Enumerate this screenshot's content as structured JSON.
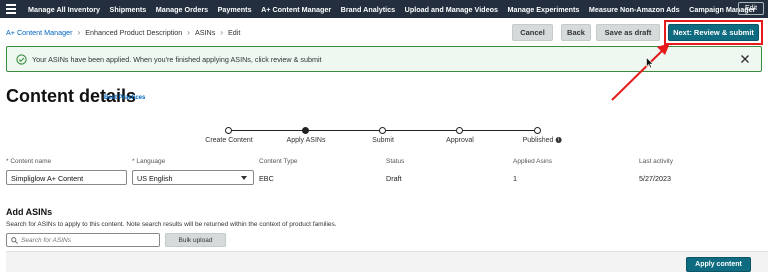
{
  "topnav": {
    "items": [
      "Manage All Inventory",
      "Shipments",
      "Manage Orders",
      "Payments",
      "A+ Content Manager",
      "Brand Analytics",
      "Upload and Manage Videos",
      "Manage Experiments",
      "Measure Non-Amazon Ads",
      "Campaign Manager"
    ],
    "edit_label": "Edit"
  },
  "breadcrumb": {
    "root": "A+ Content Manager",
    "items": [
      "Enhanced Product Description",
      "ASINs",
      "Edit"
    ]
  },
  "actions": {
    "cancel": "Cancel",
    "back": "Back",
    "save_draft": "Save as draft",
    "submit": "Next: Review & submit"
  },
  "alert": {
    "message": "Your ASINs have been applied. When you're finished applying ASINs, click review & submit"
  },
  "page": {
    "title": "Content details",
    "best_practices": "Best Practices"
  },
  "stepper": {
    "steps": [
      "Create Content",
      "Apply ASINs",
      "Submit",
      "Approval",
      "Published"
    ],
    "current_step": 2
  },
  "details": {
    "content_name_label": "* Content name",
    "content_name_value": "Simpliglow A+ Content",
    "language_label": "* Language",
    "language_value": "US English",
    "content_type_label": "Content Type",
    "content_type_value": "EBC",
    "status_label": "Status",
    "status_value": "Draft",
    "applied_asins_label": "Applied Asins",
    "applied_asins_value": "1",
    "last_activity_label": "Last activity",
    "last_activity_value": "5/27/2023"
  },
  "add_asins": {
    "title": "Add ASINs",
    "description": "Search for ASINs to apply to this content. Note search results will be returned within the context of product families.",
    "search_placeholder": "Search for ASINs",
    "bulk_upload": "Bulk upload",
    "apply_content": "Apply content"
  },
  "colors": {
    "nav_bg": "#232f3e",
    "primary_button": "#0f6b7f",
    "alert_border": "#3b8c3e",
    "highlight": "#e51b1b"
  }
}
